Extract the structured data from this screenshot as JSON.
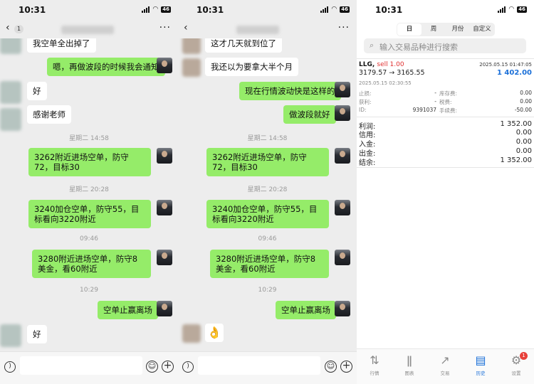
{
  "status": {
    "time": "10:31",
    "battery": "46"
  },
  "chat1": {
    "unread_badge": "1",
    "messages": [
      "我空单全出掉了",
      "嗯，再做波段的时候我会通知",
      "好",
      "感谢老师",
      "3262附近进场空单，防守72，目标30",
      "3240加仓空单，防守55，目标看向3220附近",
      "3280附近进场空单，防守8美金，看60附近",
      "空单止赢离场",
      "好"
    ],
    "timestamps": [
      "星期二 14:58",
      "星期二 20:28",
      "09:46",
      "10:29"
    ]
  },
  "chat2": {
    "messages": [
      "这才几天就到位了",
      "我还以为要拿大半个月",
      "现在行情波动快是这样的",
      "做波段就好",
      "3262附近进场空单，防守72，目标30",
      "3240加仓空单，防守55，目标看向3220附近",
      "3280附近进场空单，防守8美金，看60附近",
      "空单止赢离场"
    ],
    "timestamps": [
      "星期二 14:58",
      "星期二 20:28",
      "09:46",
      "10:29"
    ],
    "last_emoji": "👌"
  },
  "trade": {
    "segments": [
      "日",
      "周",
      "月份",
      "自定义"
    ],
    "active_segment": "日",
    "search_placeholder": "输入交易品种进行搜索",
    "order": {
      "symbol": "LLG,",
      "side": "sell 1.00",
      "close_time": "2025.05.15 01:47:05",
      "prices": "3179.57 → 3165.55",
      "profit": "1 402.00",
      "open_time": "2025.05.15 02:30:55",
      "sl_label": "止损:",
      "sl_value": "-",
      "tp_label": "获利:",
      "tp_value": "-",
      "id_label": "ID:",
      "id_value": "9391037",
      "swap_label": "库存费:",
      "swap_value": "0.00",
      "tax_label": "税费:",
      "tax_value": "0.00",
      "fee_label": "手续费:",
      "fee_value": "-50.00"
    },
    "summary": [
      {
        "label": "利润:",
        "value": "1 352.00"
      },
      {
        "label": "信用:",
        "value": "0.00"
      },
      {
        "label": "入金:",
        "value": "0.00"
      },
      {
        "label": "出金:",
        "value": "0.00"
      },
      {
        "label": "结余:",
        "value": "1 352.00"
      }
    ],
    "tabs": [
      {
        "label": "行情",
        "icon": "quotes-icon"
      },
      {
        "label": "图表",
        "icon": "chart-icon"
      },
      {
        "label": "交易",
        "icon": "trade-icon"
      },
      {
        "label": "历史",
        "icon": "history-icon"
      },
      {
        "label": "设置",
        "icon": "settings-icon"
      }
    ],
    "active_tab": "历史",
    "settings_badge": "1",
    "colors": {
      "sell": "#e03030",
      "profit": "#1a6fd8",
      "active_tab": "#1a6fd8",
      "bubble_out": "#95ec69"
    }
  }
}
